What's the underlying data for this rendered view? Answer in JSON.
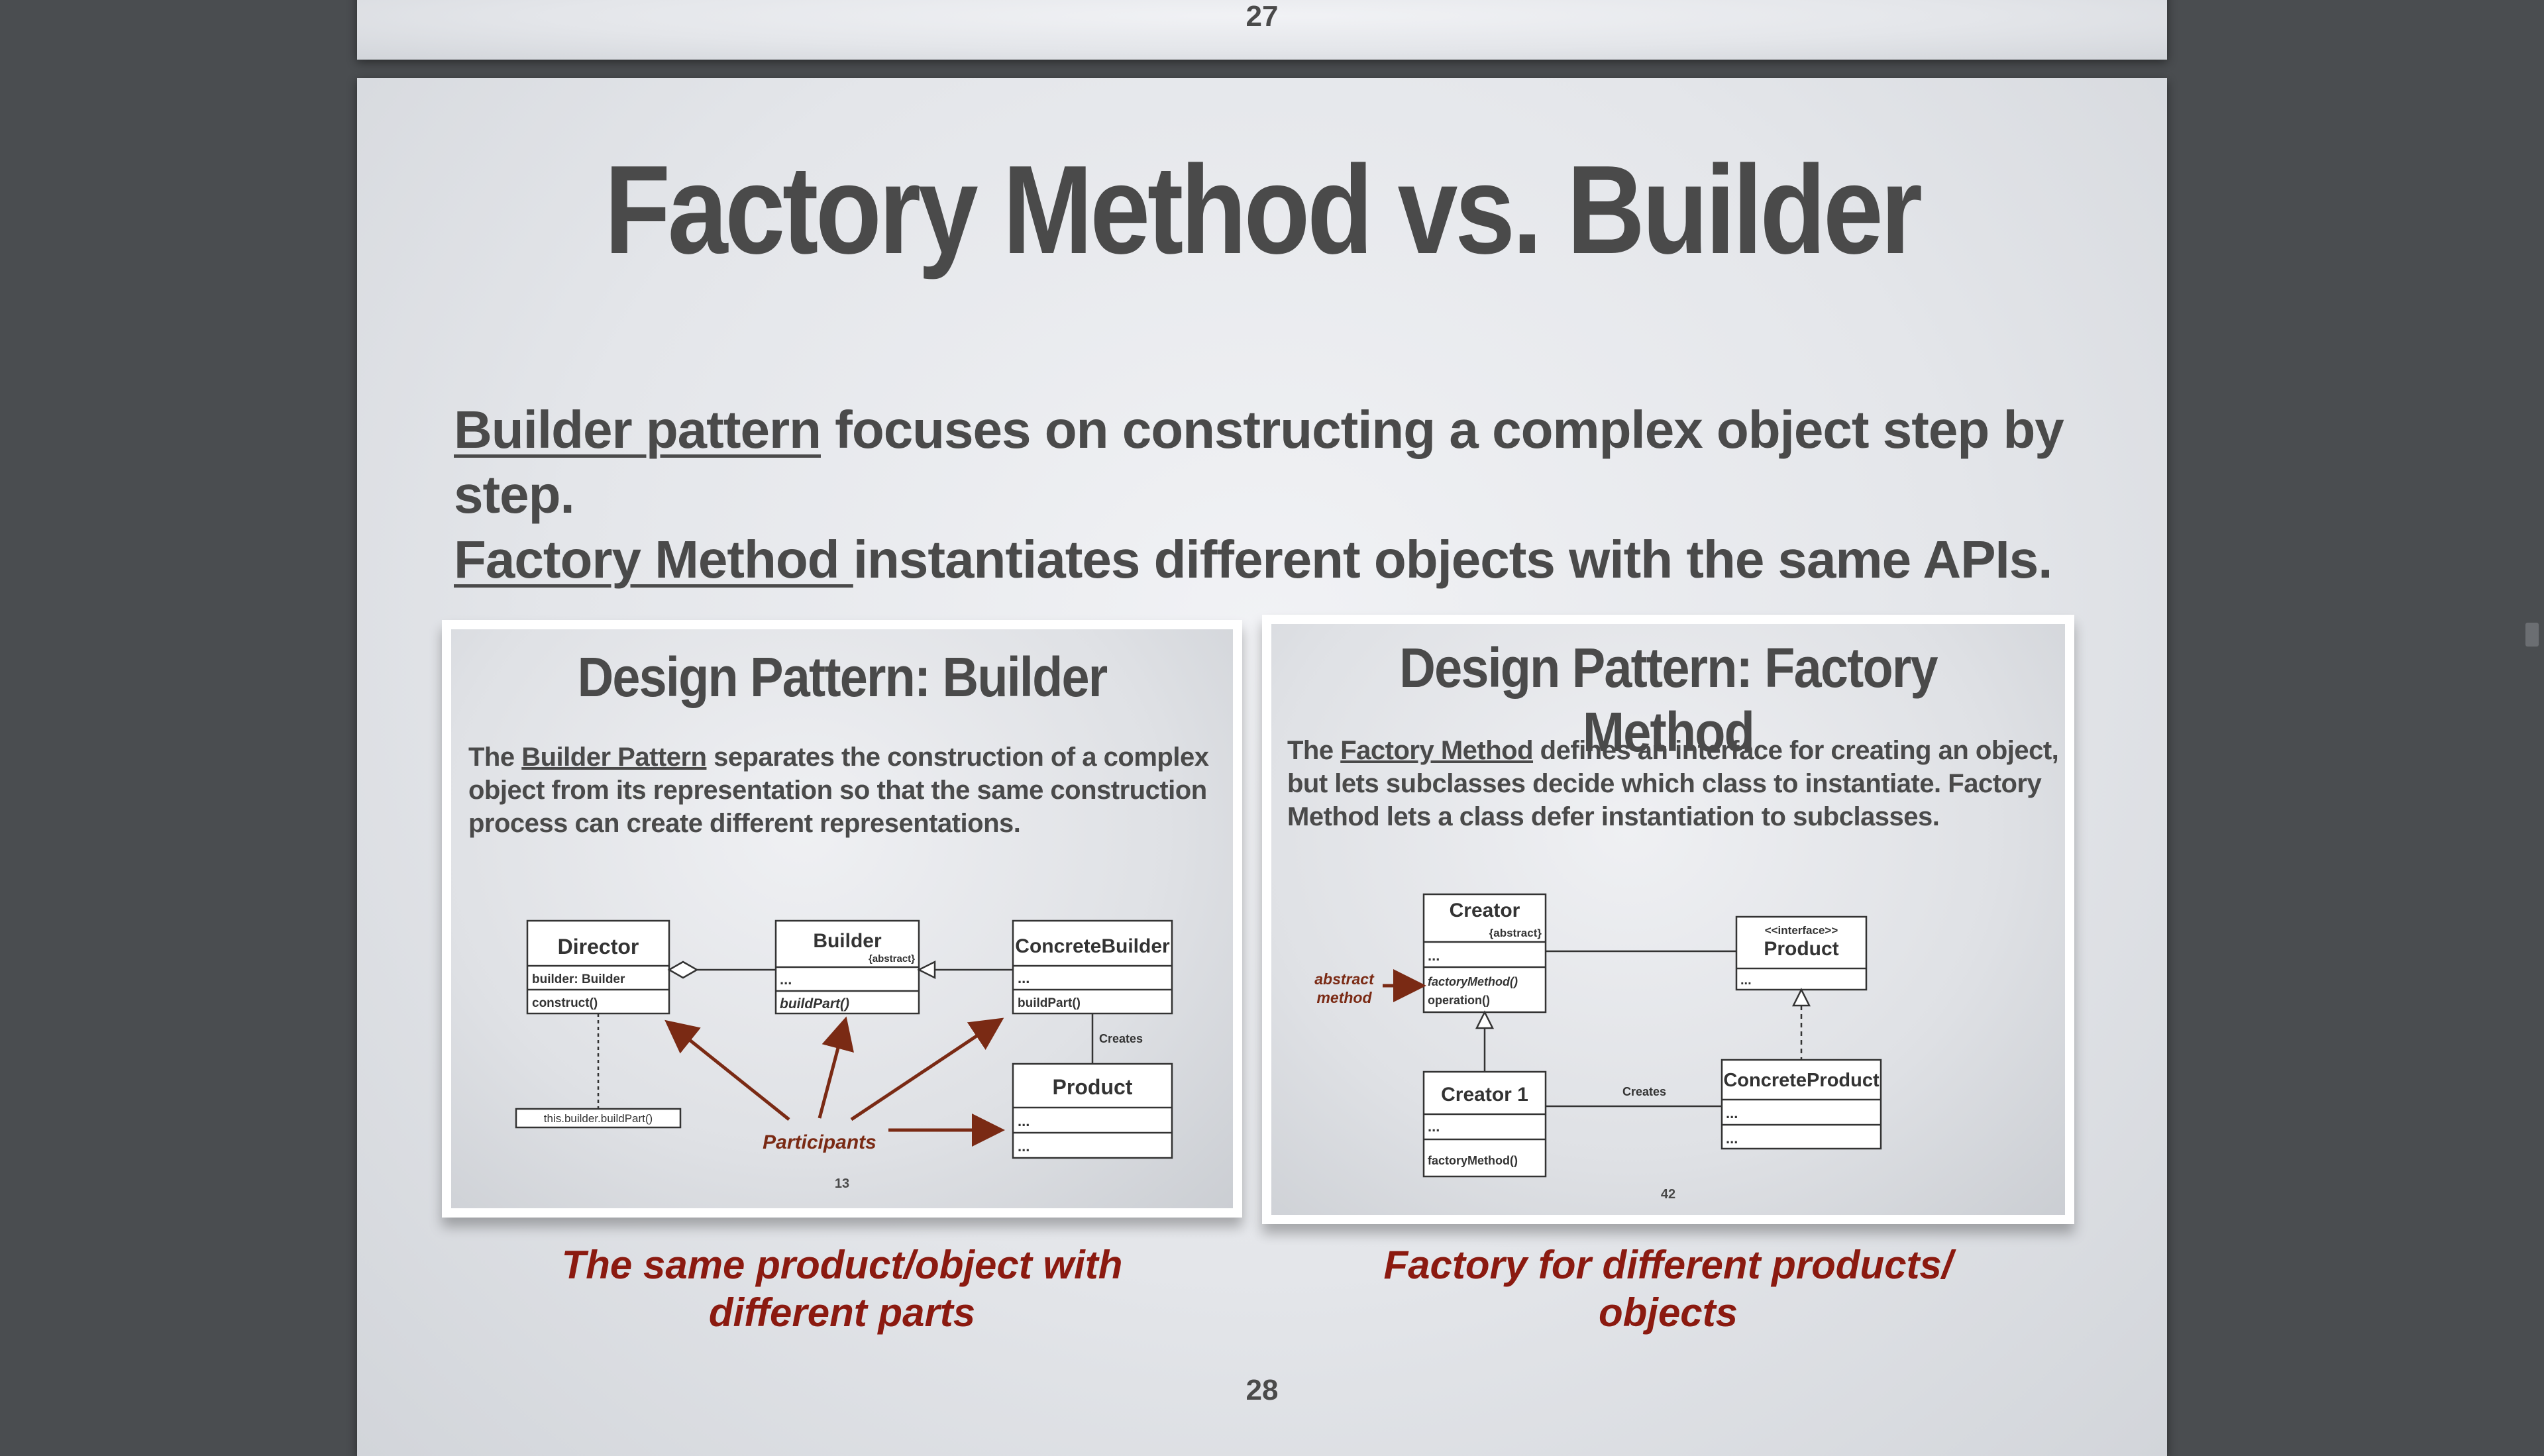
{
  "prev_slide": {
    "page_number": "27"
  },
  "slide": {
    "title": "Factory Method vs. Builder",
    "intro": {
      "line1_link": "Builder pattern",
      "line1_rest": " focuses on constructing a complex object step by step.",
      "line2_link": "Factory Method ",
      "line2_rest": "instantiates different objects with the same APIs."
    },
    "builder_card": {
      "title": "Design Pattern: Builder",
      "desc_pre": "The ",
      "desc_link": "Builder Pattern",
      "desc_post": " separates the construction of a complex object from its representation so that the same construction process can create different representations.",
      "page_number": "13",
      "diagram": {
        "director": "Director",
        "director_attr": "builder: Builder",
        "director_op": "construct()",
        "builder": "Builder",
        "builder_stereo": "{abstract}",
        "builder_attr": "...",
        "builder_op": "buildPart()",
        "concrete_builder": "ConcreteBuilder",
        "concrete_attr": "...",
        "concrete_op": "buildPart()",
        "creates": "Creates",
        "product": "Product",
        "product_attr": "...",
        "product_op": "...",
        "note": "this.builder.buildPart()",
        "participants": "Participants"
      }
    },
    "factory_card": {
      "title": "Design Pattern: Factory Method",
      "desc_pre": "The ",
      "desc_link": "Factory Method",
      "desc_post": " defines an interface for creating an object, but lets subclasses decide which class to instantiate. Factory Method lets a class defer instantiation to subclasses.",
      "page_number": "42",
      "diagram": {
        "creator": "Creator",
        "creator_stereo": "{abstract}",
        "creator_attr": "...",
        "creator_op1": "factoryMethod()",
        "creator_op2": "operation()",
        "abstract_label1": "abstract",
        "abstract_label2": "method",
        "product_stereo": "<<interface>>",
        "product": "Product",
        "product_attr": "...",
        "creator1": "Creator 1",
        "creator1_attr": "...",
        "creator1_op": "factoryMethod()",
        "creates": "Creates",
        "concrete_product": "ConcreteProduct",
        "cp_attr": "...",
        "cp_op": "..."
      }
    },
    "caption_left_1": "The same product/object with",
    "caption_left_2": "different parts",
    "caption_right_1": "Factory for different products/",
    "caption_right_2": "objects",
    "page_number": "28"
  },
  "colors": {
    "accent_red": "#8b1a10",
    "text_gray": "#4a4a4a",
    "background": "#4a4d50"
  }
}
